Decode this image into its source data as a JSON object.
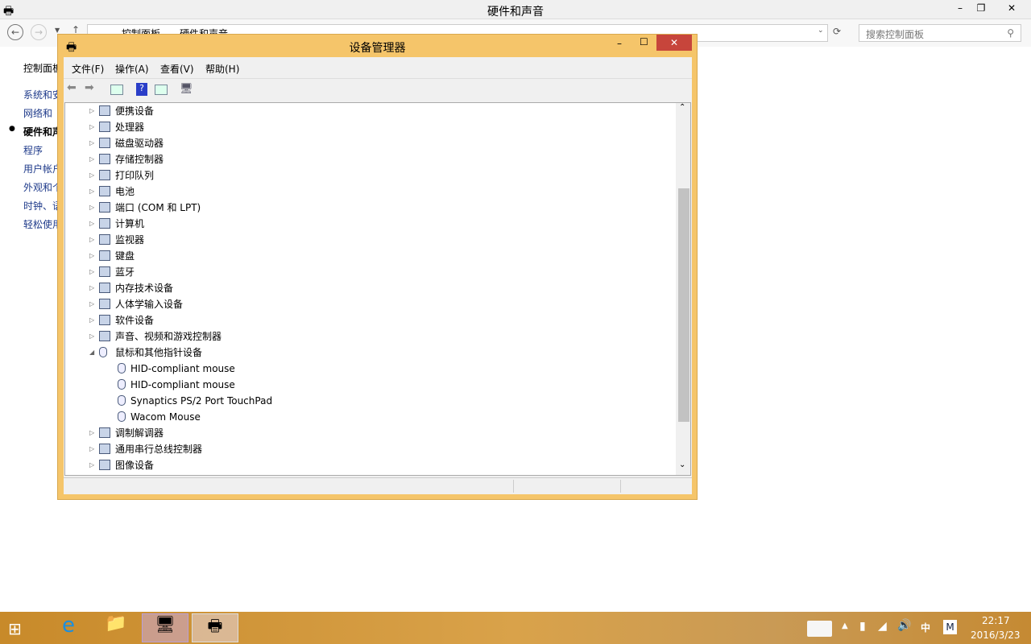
{
  "control_panel": {
    "title": "硬件和声音",
    "breadcrumb": [
      "控制面板",
      "硬件和声音"
    ],
    "search_placeholder": "搜索控制面板",
    "nav": [
      "控制面板",
      "系统和安",
      "网络和",
      "硬件和声",
      "程序",
      "用户帐户",
      "外观和个",
      "时钟、语",
      "轻松使用"
    ],
    "active_nav": 3
  },
  "device_manager": {
    "title": "设备管理器",
    "menu": [
      "文件(F)",
      "操作(A)",
      "查看(V)",
      "帮助(H)"
    ],
    "tree": [
      {
        "label": "便携设备",
        "level": 1,
        "expanded": false,
        "icon": "portable-device-icon"
      },
      {
        "label": "处理器",
        "level": 1,
        "expanded": false,
        "icon": "processor-icon"
      },
      {
        "label": "磁盘驱动器",
        "level": 1,
        "expanded": false,
        "icon": "disk-drive-icon"
      },
      {
        "label": "存储控制器",
        "level": 1,
        "expanded": false,
        "icon": "storage-controller-icon"
      },
      {
        "label": "打印队列",
        "level": 1,
        "expanded": false,
        "icon": "printer-icon"
      },
      {
        "label": "电池",
        "level": 1,
        "expanded": false,
        "icon": "battery-icon"
      },
      {
        "label": "端口 (COM 和 LPT)",
        "level": 1,
        "expanded": false,
        "icon": "port-icon"
      },
      {
        "label": "计算机",
        "level": 1,
        "expanded": false,
        "icon": "computer-icon"
      },
      {
        "label": "监视器",
        "level": 1,
        "expanded": false,
        "icon": "monitor-icon"
      },
      {
        "label": "键盘",
        "level": 1,
        "expanded": false,
        "icon": "keyboard-icon"
      },
      {
        "label": "蓝牙",
        "level": 1,
        "expanded": false,
        "icon": "bluetooth-icon"
      },
      {
        "label": "内存技术设备",
        "level": 1,
        "expanded": false,
        "icon": "memory-icon"
      },
      {
        "label": "人体学输入设备",
        "level": 1,
        "expanded": false,
        "icon": "hid-icon"
      },
      {
        "label": "软件设备",
        "level": 1,
        "expanded": false,
        "icon": "software-device-icon"
      },
      {
        "label": "声音、视频和游戏控制器",
        "level": 1,
        "expanded": false,
        "icon": "sound-icon"
      },
      {
        "label": "鼠标和其他指针设备",
        "level": 1,
        "expanded": true,
        "icon": "mouse-icon"
      },
      {
        "label": "HID-compliant mouse",
        "level": 2,
        "icon": "mouse-icon"
      },
      {
        "label": "HID-compliant mouse",
        "level": 2,
        "icon": "mouse-icon"
      },
      {
        "label": "Synaptics PS/2 Port TouchPad",
        "level": 2,
        "icon": "mouse-icon"
      },
      {
        "label": "Wacom Mouse",
        "level": 2,
        "icon": "mouse-icon"
      },
      {
        "label": "调制解调器",
        "level": 1,
        "expanded": false,
        "icon": "modem-icon"
      },
      {
        "label": "通用串行总线控制器",
        "level": 1,
        "expanded": false,
        "icon": "usb-icon"
      },
      {
        "label": "图像设备",
        "level": 1,
        "expanded": false,
        "icon": "imaging-device-icon"
      }
    ]
  },
  "taskbar": {
    "time": "22:17",
    "date": "2016/3/23",
    "ime": "中",
    "ime_mode": "M"
  },
  "colors": {
    "dm_frame": "#f5c56a",
    "close": "#c7453b",
    "taskbar": "#c88a2a"
  }
}
